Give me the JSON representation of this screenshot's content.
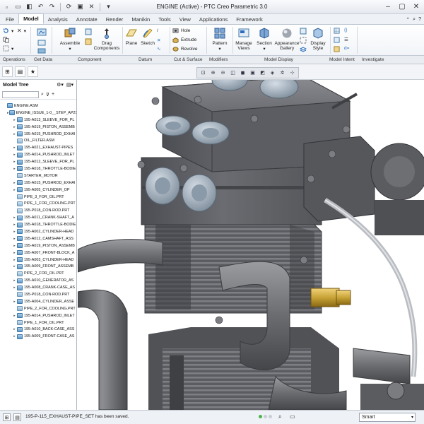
{
  "window": {
    "title": "ENGINE (Active) - PTC Creo Parametric 3.0"
  },
  "tabs": [
    "File",
    "Model",
    "Analysis",
    "Annotate",
    "Render",
    "Manikin",
    "Tools",
    "View",
    "Applications",
    "Framework"
  ],
  "ribbon": {
    "assemble": "Assemble",
    "drag_components": "Drag Components",
    "plane": "Plane",
    "sketch": "Sketch",
    "hole": "Hole",
    "extrude": "Extrude",
    "revolve": "Revolve",
    "pattern": "Pattern",
    "manage_views": "Manage Views",
    "section": "Section",
    "appearance_gallery": "Appearance Gallery",
    "display_style": "Display Style",
    "d_eq": "d="
  },
  "groups": [
    "Operations",
    "Get Data",
    "Component",
    "Datum",
    "Cut & Surface",
    "Modifiers",
    "Model Display",
    "Model Intent",
    "Investigate"
  ],
  "model_tree": {
    "title": "Model Tree",
    "nodes": [
      {
        "label": "ENGINE.ASM",
        "kind": "asm",
        "level": 0,
        "expand": ""
      },
      {
        "label": "ENGINE_ISSUE_1-0__STEP_AP21",
        "kind": "asm",
        "level": 1,
        "expand": "▸"
      },
      {
        "label": "195-A013_SLEEVE_FOR_PL",
        "kind": "asm",
        "level": 2,
        "expand": "▸"
      },
      {
        "label": "195-A019_PISTON_ASSEMB",
        "kind": "asm",
        "level": 2,
        "expand": "▸"
      },
      {
        "label": "195-A015_PUSHROD_EXHAI",
        "kind": "asm",
        "level": 2,
        "expand": "▸"
      },
      {
        "label": "OIL_FILTER.ASM",
        "kind": "part",
        "level": 2,
        "expand": ""
      },
      {
        "label": "195-A021_EXHAUST-PIPES",
        "kind": "asm",
        "level": 2,
        "expand": "▸"
      },
      {
        "label": "195-A014_PUSHROD_INLET",
        "kind": "asm",
        "level": 2,
        "expand": "▸"
      },
      {
        "label": "195-A012_SLEEVE_FOR_PL",
        "kind": "asm",
        "level": 2,
        "expand": "▸"
      },
      {
        "label": "195-A018_THROTTLE-BODIE",
        "kind": "asm",
        "level": 2,
        "expand": "▸"
      },
      {
        "label": "STARTER_MOTOR",
        "kind": "part",
        "level": 2,
        "expand": ""
      },
      {
        "label": "195-A015_PUSHROD_EXHAI",
        "kind": "asm",
        "level": 2,
        "expand": "▸"
      },
      {
        "label": "195-A005_CYLINDER_OP",
        "kind": "asm",
        "level": 2,
        "expand": "▸"
      },
      {
        "label": "PIPE_3_FOR_OIL.PRT",
        "kind": "part",
        "level": 2,
        "expand": ""
      },
      {
        "label": "PIPE_1_FOR_COOLING.PRT",
        "kind": "part",
        "level": 2,
        "expand": ""
      },
      {
        "label": "195-P018_CON-ROD.PRT",
        "kind": "part",
        "level": 2,
        "expand": ""
      },
      {
        "label": "195-A011_CRANK-SHAFT_A",
        "kind": "asm",
        "level": 2,
        "expand": "▸"
      },
      {
        "label": "195-A018_THROTTLE-BODIE",
        "kind": "asm",
        "level": 2,
        "expand": "▸"
      },
      {
        "label": "195-A002_CYLINDER-HEAD",
        "kind": "asm",
        "level": 2,
        "expand": "▸"
      },
      {
        "label": "195-A012_CAMSHAFT_ASS",
        "kind": "asm",
        "level": 2,
        "expand": "▸"
      },
      {
        "label": "195-A019_PISTON_ASSEMB",
        "kind": "asm",
        "level": 2,
        "expand": "▸"
      },
      {
        "label": "195-A007_FRONT-BLOCK_A",
        "kind": "asm",
        "level": 2,
        "expand": "▸"
      },
      {
        "label": "195-A003_CYLINDER-HEAD",
        "kind": "asm",
        "level": 2,
        "expand": "▸"
      },
      {
        "label": "195-A009_FRONT_ASSEMB",
        "kind": "asm",
        "level": 2,
        "expand": "▸"
      },
      {
        "label": "PIPE_2_FOR_OIL.PRT",
        "kind": "part",
        "level": 2,
        "expand": ""
      },
      {
        "label": "195-A010_GENERATOR_AS",
        "kind": "asm",
        "level": 2,
        "expand": "▸"
      },
      {
        "label": "195-A008_CRANK-CASE_AS",
        "kind": "asm",
        "level": 2,
        "expand": "▸"
      },
      {
        "label": "195-P018_CON-ROD.PRT",
        "kind": "part",
        "level": 2,
        "expand": ""
      },
      {
        "label": "195-A004_CYLINDER_ASSE",
        "kind": "asm",
        "level": 2,
        "expand": "▸"
      },
      {
        "label": "PIPE_2_FOR_COOLING.PRT",
        "kind": "part",
        "level": 2,
        "expand": ""
      },
      {
        "label": "195-A014_PUSHROD_INLET",
        "kind": "asm",
        "level": 2,
        "expand": "▸"
      },
      {
        "label": "PIPE_1_FOR_OIL.PRT",
        "kind": "part",
        "level": 2,
        "expand": ""
      },
      {
        "label": "195-A010_BACK-CASE_ASS",
        "kind": "asm",
        "level": 2,
        "expand": "▸"
      },
      {
        "label": "195-A009_FRONT-CASE_AS",
        "kind": "asm",
        "level": 2,
        "expand": "▸"
      }
    ]
  },
  "statusbar": {
    "message": "195-P-115_EXHAUST-PIPE_SET has been saved.",
    "filter_value": "Smart"
  },
  "colors": {
    "metal": "#5f6166",
    "metal_light": "#8a8c91",
    "cap": "#a4b2c0",
    "pipe": "#6a6c70",
    "brass": "#c8a337",
    "accent_blue": "#2a6ebb"
  },
  "icons": [
    "undo-icon",
    "redo-icon",
    "save-icon",
    "close-icon",
    "minimize-icon",
    "maximize-icon",
    "help-icon",
    "search-icon",
    "filter-icon",
    "settings-icon"
  ]
}
